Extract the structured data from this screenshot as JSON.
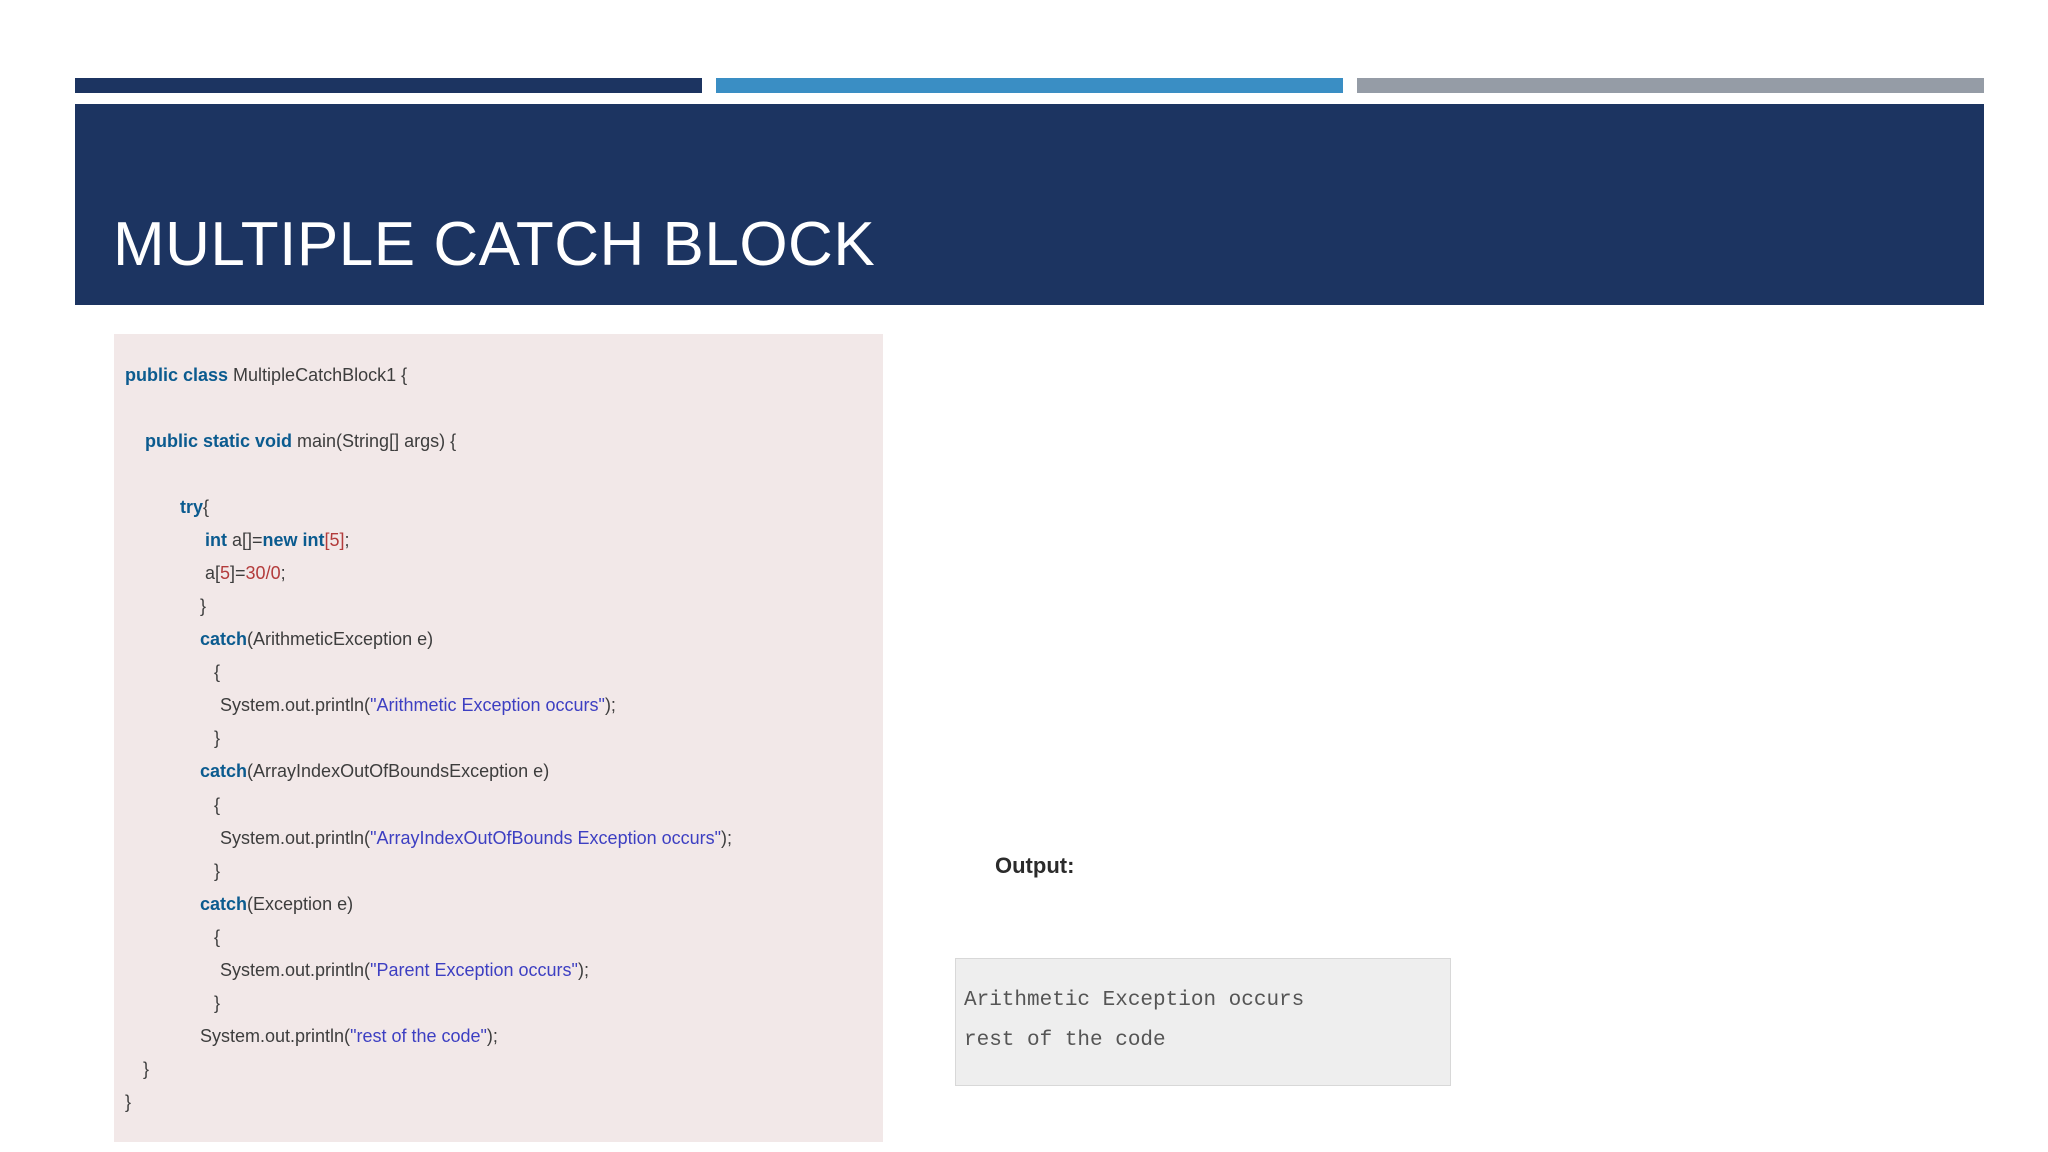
{
  "colors": {
    "navy": "#1c3461",
    "blue": "#3a8ec4",
    "gray": "#959ca6",
    "code_bg": "#f2e8e8",
    "keyword": "#0b5b8f",
    "string": "#3d3fc2",
    "number": "#b33b3b",
    "output_bg": "#eeeeee"
  },
  "slide": {
    "title": "MULTIPLE CATCH BLOCK"
  },
  "code": {
    "line1": {
      "kw": "public class",
      "rest": " MultipleCatchBlock1 {"
    },
    "line2": {
      "kw": "public static void",
      "rest": " main(String[] args) {"
    },
    "line3": {
      "kw": "try",
      "rest": "{"
    },
    "line4": {
      "kw1": "int",
      "mid": " a[]=",
      "kw2": "new int",
      "num": "[5]",
      "end": ";"
    },
    "line5": {
      "pre": "a[",
      "num1": "5",
      "mid": "]=",
      "num2": "30/0",
      "end": ";"
    },
    "line6": "}",
    "line7": {
      "kw": "catch",
      "rest": "(ArithmeticException e)"
    },
    "line8": "{",
    "line9": {
      "pre": "System.out.println(",
      "str": "\"Arithmetic Exception occurs\"",
      "end": ");"
    },
    "line10": "}",
    "line11": {
      "kw": "catch",
      "rest": "(ArrayIndexOutOfBoundsException e)"
    },
    "line12": "{",
    "line13": {
      "pre": "System.out.println(",
      "str": "\"ArrayIndexOutOfBounds Exception occurs\"",
      "end": ");"
    },
    "line14": "}",
    "line15": {
      "kw": "catch",
      "rest": "(Exception e)"
    },
    "line16": "{",
    "line17": {
      "pre": "System.out.println(",
      "str": "\"Parent Exception occurs\"",
      "end": ");"
    },
    "line18": "}",
    "line19": {
      "pre": "System.out.println(",
      "str": "\"rest of the code\"",
      "end": ");"
    },
    "line20": "}",
    "line21": "}"
  },
  "output": {
    "label": "Output:",
    "lines": [
      "Arithmetic Exception occurs",
      "rest of the code"
    ]
  }
}
